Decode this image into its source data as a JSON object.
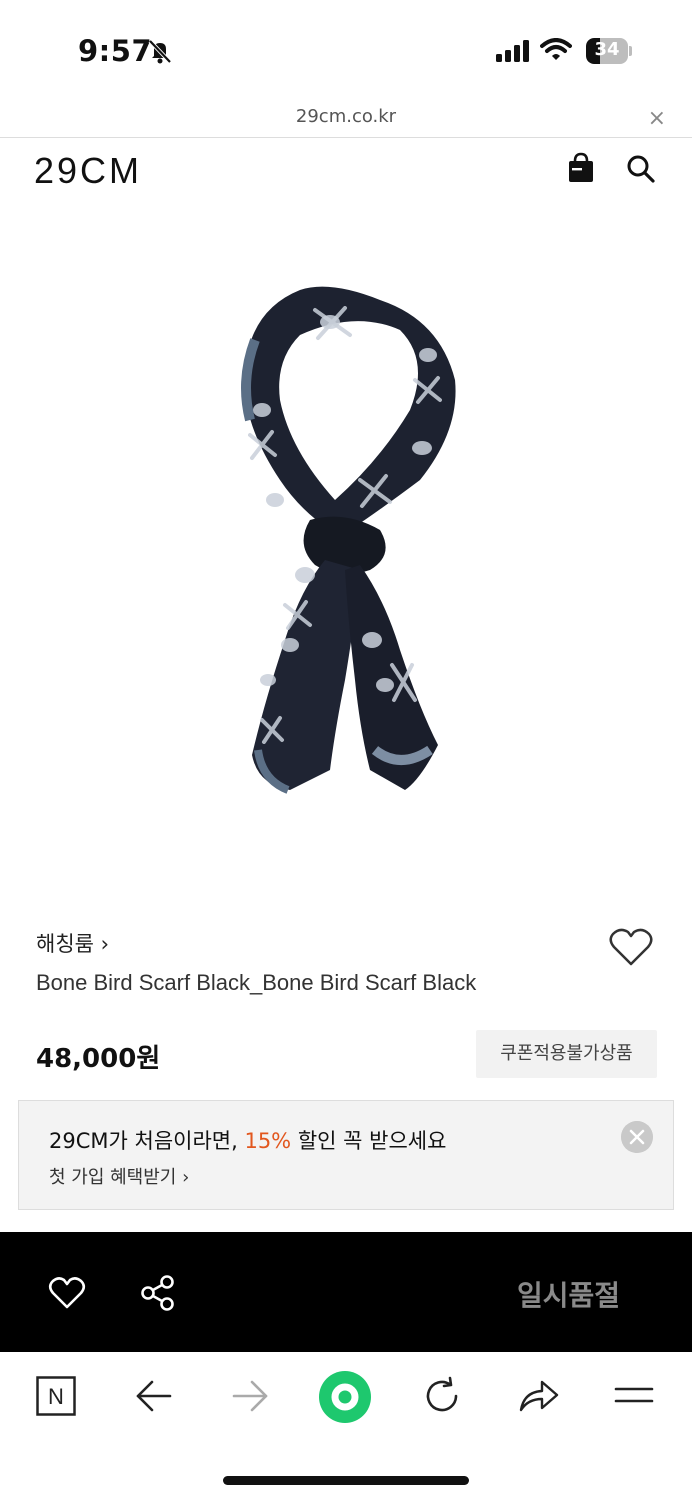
{
  "status_bar": {
    "time": "9:57",
    "battery": "34",
    "battery_level_percent": 34,
    "icons": [
      "bell-slash-icon",
      "signal-icon",
      "wifi-icon",
      "battery-icon"
    ]
  },
  "browser": {
    "url": "29cm.co.kr",
    "close_label": "×"
  },
  "header": {
    "logo": "29CM",
    "icons": [
      "shopping-bag-icon",
      "search-icon"
    ]
  },
  "product": {
    "brand": "해칭룸 ›",
    "name": "Bone Bird Scarf Black_Bone Bird Scarf Black",
    "price": "48,000원",
    "coupon_badge": "쿠폰적용불가상품"
  },
  "promo": {
    "title_before": "29CM가 처음이라면, ",
    "highlight": "15%",
    "title_after": " 할인 꼭 받으세요",
    "subtitle": "첫 가입 혜택받기 ›",
    "highlight_color": "#e2571e"
  },
  "action_bar": {
    "soldout_label": "일시품절",
    "icons": [
      "heart-icon",
      "share-icon"
    ]
  },
  "toolbar": {
    "n_label": "N",
    "icons": [
      "naver-n-icon",
      "back-arrow-icon",
      "forward-arrow-icon",
      "green-circle-icon",
      "refresh-icon",
      "share-arrow-icon",
      "menu-icon"
    ],
    "accent": "#1ec86e"
  }
}
